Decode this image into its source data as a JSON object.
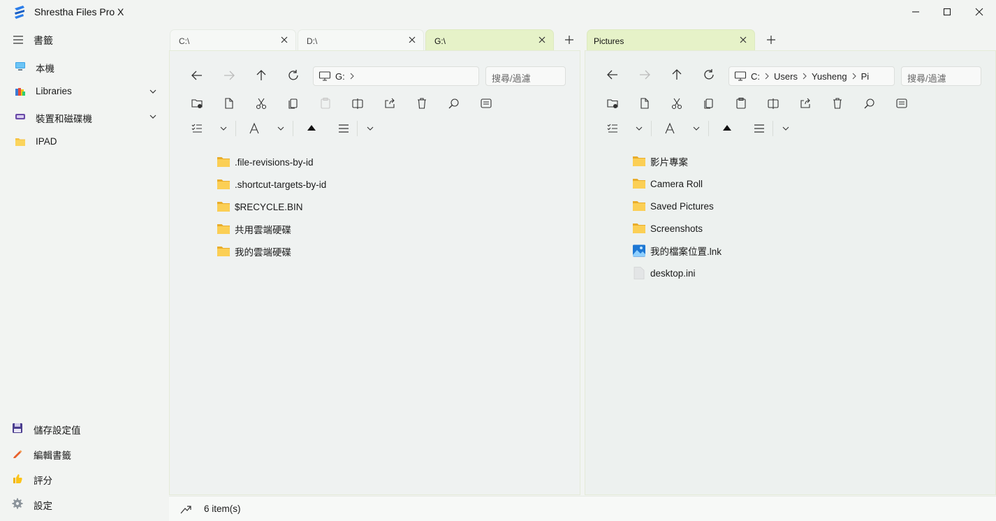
{
  "window": {
    "title": "Shrestha Files Pro X"
  },
  "sidebar": {
    "bookmarks_title": "書籤",
    "items": [
      {
        "label": "本機",
        "icon": "monitor-icon",
        "expandable": false
      },
      {
        "label": "Libraries",
        "icon": "libraries-icon",
        "expandable": true
      },
      {
        "label": "裝置和磁碟機",
        "icon": "drive-icon",
        "expandable": true
      },
      {
        "label": "IPAD",
        "icon": "folder-icon",
        "expandable": false
      }
    ],
    "bottom": [
      {
        "label": "儲存設定值",
        "icon": "floppy-disk-icon"
      },
      {
        "label": "編輯書籤",
        "icon": "pencil-icon"
      },
      {
        "label": "評分",
        "icon": "thumbs-up-icon"
      },
      {
        "label": "設定",
        "icon": "gear-icon"
      }
    ]
  },
  "left_pane": {
    "tabs": [
      {
        "label": "C:\\",
        "active": false
      },
      {
        "label": "D:\\",
        "active": false
      },
      {
        "label": "G:\\",
        "active": true
      }
    ],
    "address": [
      "G:"
    ],
    "search_placeholder": "搜尋/過濾",
    "files": [
      {
        "name": ".file-revisions-by-id",
        "type": "folder"
      },
      {
        "name": ".shortcut-targets-by-id",
        "type": "folder"
      },
      {
        "name": "$RECYCLE.BIN",
        "type": "folder"
      },
      {
        "name": "共用雲端硬碟",
        "type": "folder"
      },
      {
        "name": "我的雲端硬碟",
        "type": "folder"
      }
    ]
  },
  "right_pane": {
    "tabs": [
      {
        "label": "Pictures",
        "active": true
      }
    ],
    "address": [
      "C:",
      "Users",
      "Yusheng",
      "Pi"
    ],
    "search_placeholder": "搜尋/過濾",
    "files": [
      {
        "name": "影片專案",
        "type": "folder"
      },
      {
        "name": "Camera Roll",
        "type": "folder"
      },
      {
        "name": "Saved Pictures",
        "type": "folder"
      },
      {
        "name": "Screenshots",
        "type": "folder"
      },
      {
        "name": "我的檔案位置.lnk",
        "type": "image-shortcut"
      },
      {
        "name": "desktop.ini",
        "type": "file"
      }
    ]
  },
  "status": {
    "items_text": "6 item(s)"
  },
  "colors": {
    "active_tab": "#e6f2c8",
    "folder": "#f5c242",
    "accent": "#1e6fd9"
  }
}
